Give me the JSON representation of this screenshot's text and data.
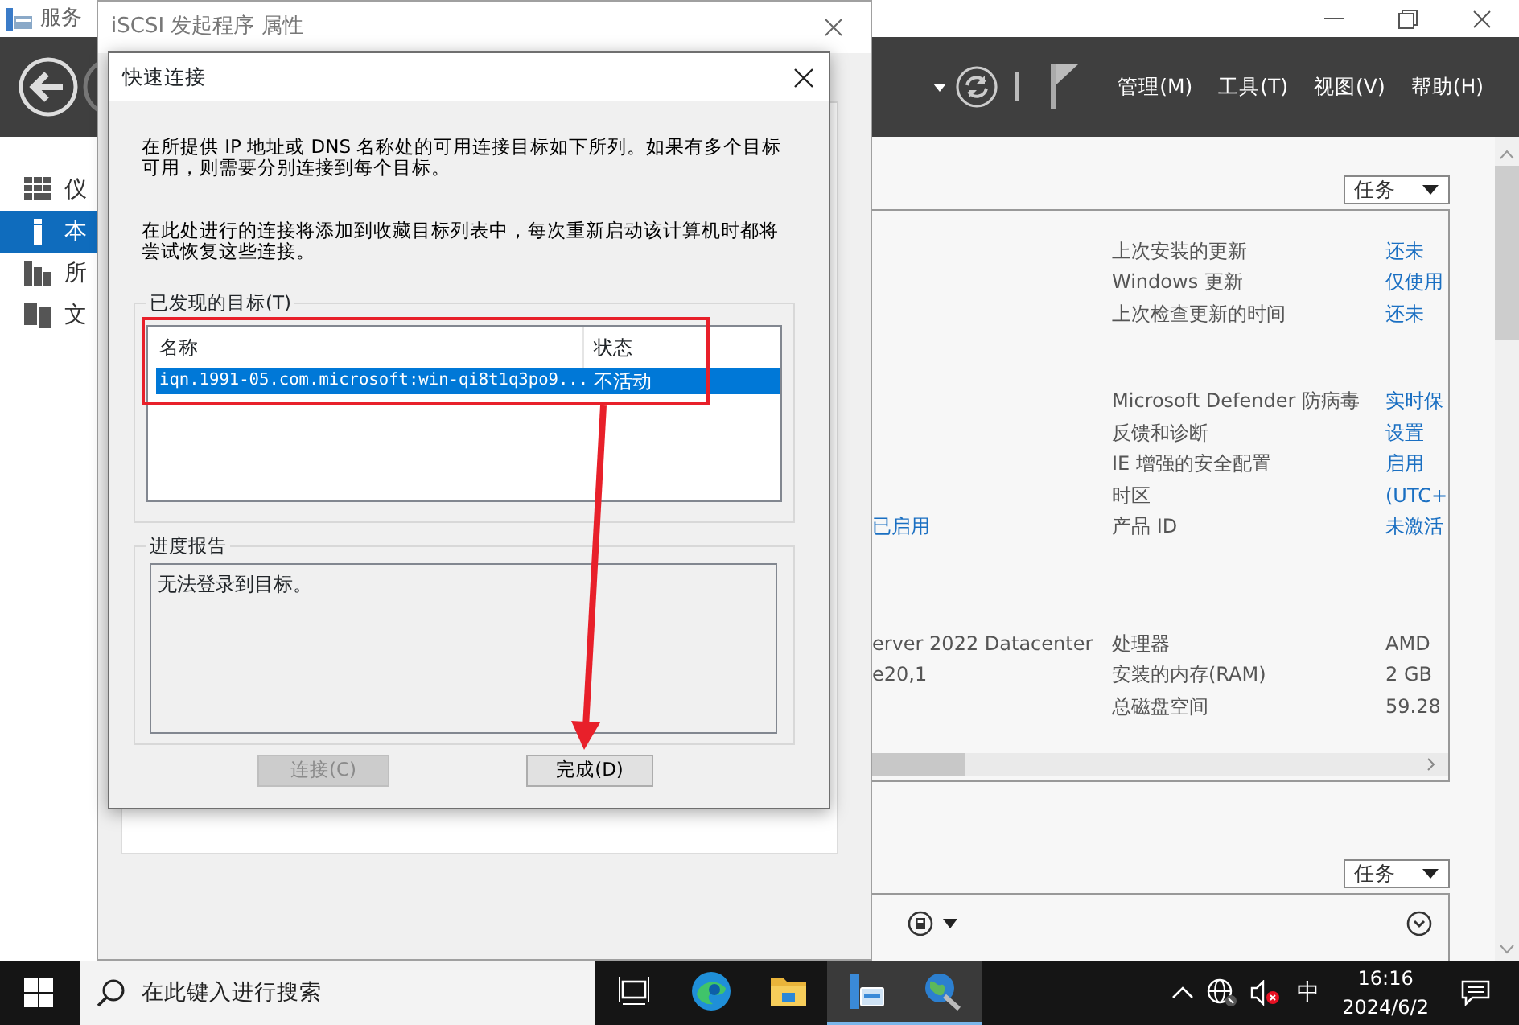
{
  "server_manager": {
    "title": "服务",
    "menus": [
      "管理(M)",
      "工具(T)",
      "视图(V)",
      "帮助(H)"
    ],
    "sidebar": [
      {
        "label": "仪",
        "selected": false
      },
      {
        "label": "本",
        "selected": true
      },
      {
        "label": "所",
        "selected": false
      },
      {
        "label": "文",
        "selected": false
      }
    ],
    "tasks_label": "任务",
    "sections": [
      [
        {
          "label": "上次安装的更新",
          "value": "还未",
          "value_link": true
        },
        {
          "label": "Windows 更新",
          "value": "仅使用",
          "value_link": true
        },
        {
          "label": "上次检查更新的时间",
          "value": "还未",
          "value_link": true
        }
      ],
      [
        {
          "label": "Microsoft Defender 防病毒",
          "value": "实时保",
          "value_link": true
        },
        {
          "label": "反馈和诊断",
          "value": "设置",
          "value_link": true
        },
        {
          "label": "IE 增强的安全配置",
          "value": "启用",
          "value_link": true
        },
        {
          "label": "时区",
          "value": "(UTC+",
          "value_link": true
        },
        {
          "left": "已启用",
          "left_link": true,
          "label": "产品 ID",
          "value": "未激活",
          "value_link": true
        }
      ],
      [
        {
          "left": "erver 2022 Datacenter",
          "left_link": false,
          "label": "处理器",
          "value": "AMD",
          "value_link": false
        },
        {
          "left": "e20,1",
          "left_link": false,
          "label": "安装的内存(RAM)",
          "value": "2 GB",
          "value_link": false
        },
        {
          "label": "总磁盘空间",
          "value": "59.28",
          "value_link": false
        }
      ]
    ],
    "tasks_label_2": "任务"
  },
  "iscsi_window": {
    "title": "iSCSI 发起程序 属性"
  },
  "quick_connect": {
    "title": "快速连接",
    "paragraphs": [
      "在所提供 IP 地址或 DNS 名称处的可用连接目标如下所列。如果有多个目标可用，则需要分别连接到每个目标。",
      "在此处进行的连接将添加到收藏目标列表中，每次重新启动该计算机时都将尝试恢复这些连接。"
    ],
    "targets_group": "已发现的目标(T)",
    "columns": [
      "名称",
      "状态"
    ],
    "rows": [
      {
        "name": "iqn.1991-05.com.microsoft:win-qi8t1q3po9...",
        "status": "不活动",
        "selected": true
      }
    ],
    "progress_group": "进度报告",
    "progress_text": "无法登录到目标。",
    "buttons": [
      {
        "label": "连接(C)",
        "disabled": true
      },
      {
        "label": "完成(D)",
        "disabled": false
      }
    ]
  },
  "taskbar": {
    "search_placeholder": "在此键入进行搜索",
    "apps": [
      {
        "kind": "task-view",
        "active": false
      },
      {
        "kind": "edge",
        "active": false
      },
      {
        "kind": "explorer",
        "active": false
      },
      {
        "kind": "server-manager",
        "active": true
      },
      {
        "kind": "network",
        "active": true
      }
    ],
    "ime": "中",
    "time": "16:16",
    "date": "2024/6/2"
  }
}
